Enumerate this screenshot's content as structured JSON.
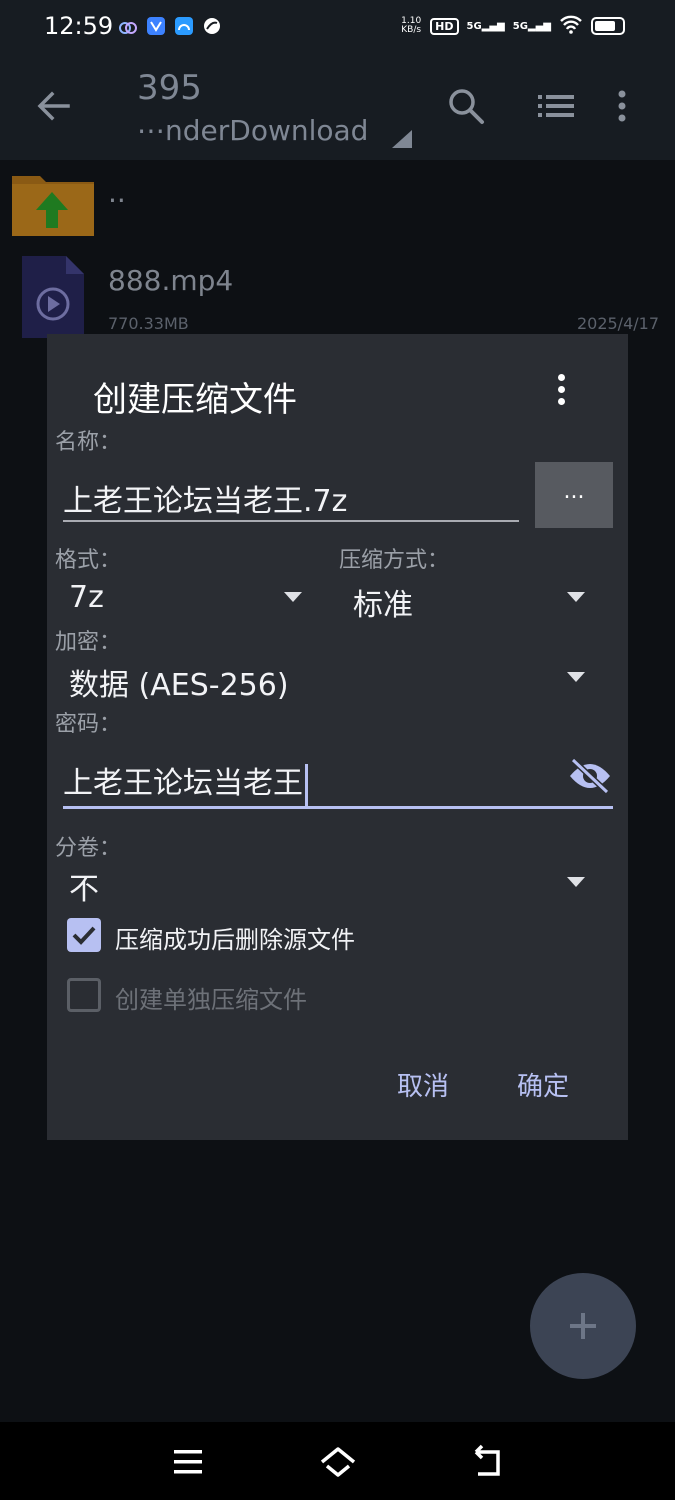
{
  "status_bar": {
    "time": "12:59",
    "net_speed_value": "1.10",
    "net_speed_unit": "KB/s",
    "hd_label": "HD",
    "signal1": "5G",
    "signal2": "5G"
  },
  "app_bar": {
    "title": "395",
    "subtitle": "⋯nderDownload"
  },
  "file_list": [
    {
      "name": "..",
      "size": "",
      "date": ""
    },
    {
      "name": "888.mp4",
      "size": "770.33MB",
      "date": "2025/4/17"
    }
  ],
  "dialog": {
    "title": "创建压缩文件",
    "name_label": "名称：",
    "name_value": "上老王论坛当老王.7z",
    "browse_label": "...",
    "format_label": "格式：",
    "format_value": "7z",
    "method_label": "压缩方式：",
    "method_value": "标准",
    "encryption_label": "加密：",
    "encryption_value": "数据 (AES-256)",
    "password_label": "密码：",
    "password_value": "上老王论坛当老王",
    "split_label": "分卷：",
    "split_value": "不",
    "delete_source_label": "压缩成功后删除源文件",
    "delete_source_checked": true,
    "separate_label": "创建单独压缩文件",
    "separate_checked": false,
    "cancel_label": "取消",
    "ok_label": "确定"
  },
  "colors": {
    "accent": "#b7c0f2",
    "dialog_bg": "#2a2d33",
    "background": "#0d1014"
  }
}
